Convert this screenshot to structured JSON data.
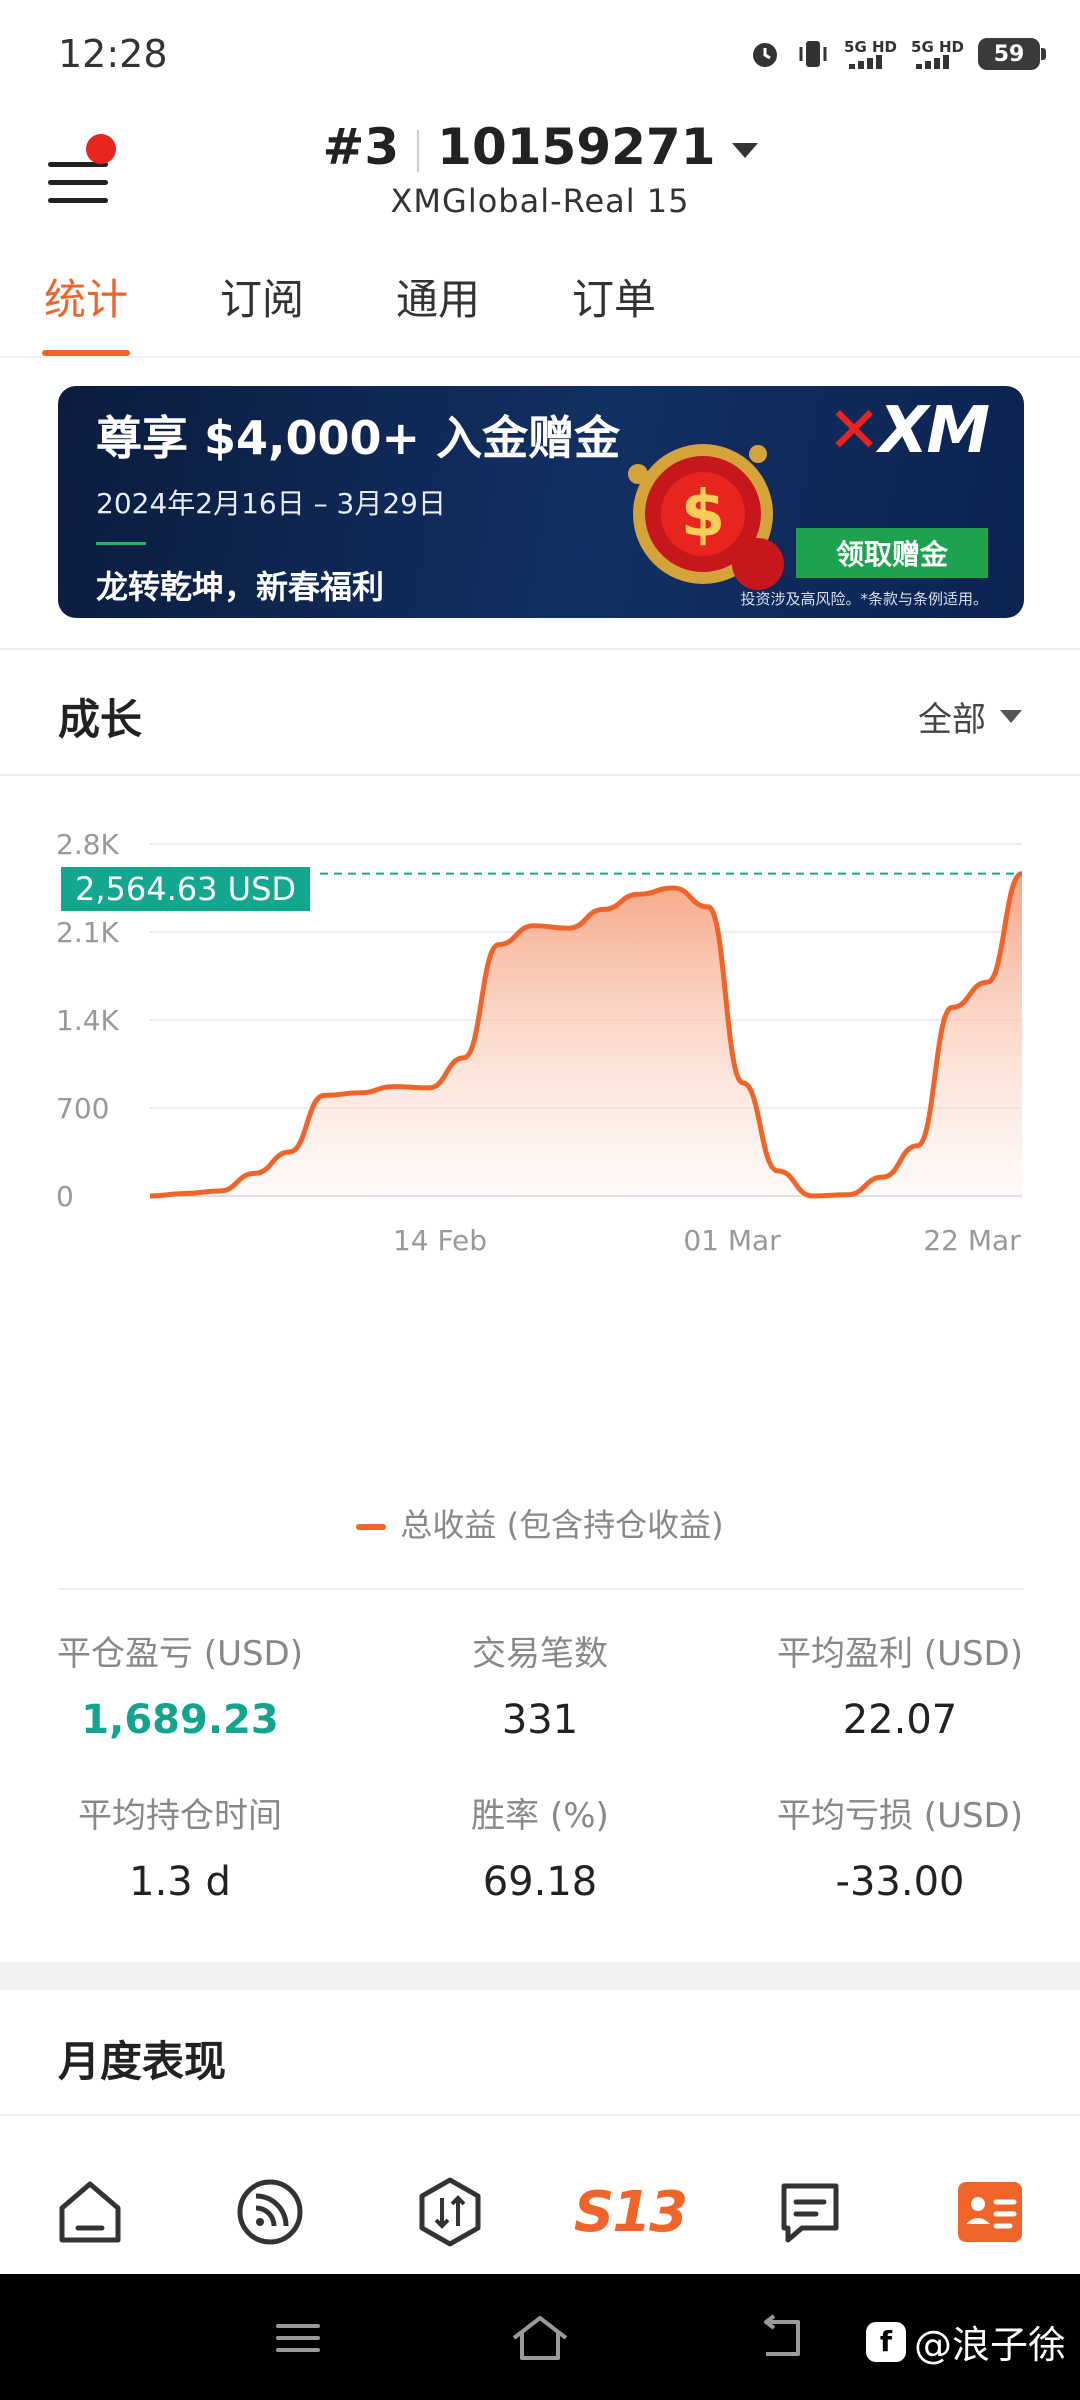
{
  "status_bar": {
    "time": "12:28",
    "network_1": "5G HD",
    "network_2": "5G HD",
    "battery": "59"
  },
  "header": {
    "account_prefix": "#3",
    "account_number": "10159271",
    "server": "XMGlobal-Real 15"
  },
  "tabs": [
    {
      "label": "统计",
      "active": true
    },
    {
      "label": "订阅",
      "active": false
    },
    {
      "label": "通用",
      "active": false
    },
    {
      "label": "订单",
      "active": false
    }
  ],
  "banner": {
    "title": "尊享 $4,000+ 入金赠金",
    "date_range": "2024年2月16日 – 3月29日",
    "subtitle": "龙转乾坤，新春福利",
    "brand": "XM",
    "cta": "领取赠金",
    "disclaimer": "投资涉及高风险。*条款与条例适用。"
  },
  "growth": {
    "title": "成长",
    "range": "全部",
    "current_value": "2,564.63 USD"
  },
  "chart_data": {
    "type": "area",
    "series": [
      {
        "name": "总收益 (包含持仓收益)",
        "color": "#f0642a",
        "values": [
          0,
          20,
          40,
          180,
          350,
          800,
          820,
          870,
          860,
          1100,
          2000,
          2150,
          2130,
          2280,
          2400,
          2450,
          2300,
          900,
          200,
          0,
          10,
          150,
          400,
          1500,
          1700,
          2564.63
        ]
      }
    ],
    "x_tick_labels": [
      "14 Feb",
      "01 Mar",
      "22 Mar"
    ],
    "y_tick_labels": [
      "0",
      "700",
      "1.4K",
      "2.1K",
      "2.8K"
    ],
    "ylim": [
      0,
      2800
    ],
    "grid": true,
    "current_line_value": 2564.63
  },
  "legend_label": "总收益 (包含持仓收益)",
  "stats": [
    {
      "label": "平仓盈亏 (USD)",
      "value": "1,689.23",
      "positive": true
    },
    {
      "label": "交易笔数",
      "value": "331"
    },
    {
      "label": "平均盈利 (USD)",
      "value": "22.07"
    },
    {
      "label": "平均持仓时间",
      "value": "1.3 d"
    },
    {
      "label": "胜率 (%)",
      "value": "69.18"
    },
    {
      "label": "平均亏损 (USD)",
      "value": "-33.00"
    }
  ],
  "monthly": {
    "title": "月度表现"
  },
  "bottom_nav": [
    "home-icon",
    "feed-icon",
    "trade-icon",
    "S13",
    "news-icon",
    "account-card-icon"
  ],
  "watermark": "@浪子徐",
  "colors": {
    "accent": "#f0642a",
    "positive": "#12a48c",
    "tag": "#14a790"
  }
}
